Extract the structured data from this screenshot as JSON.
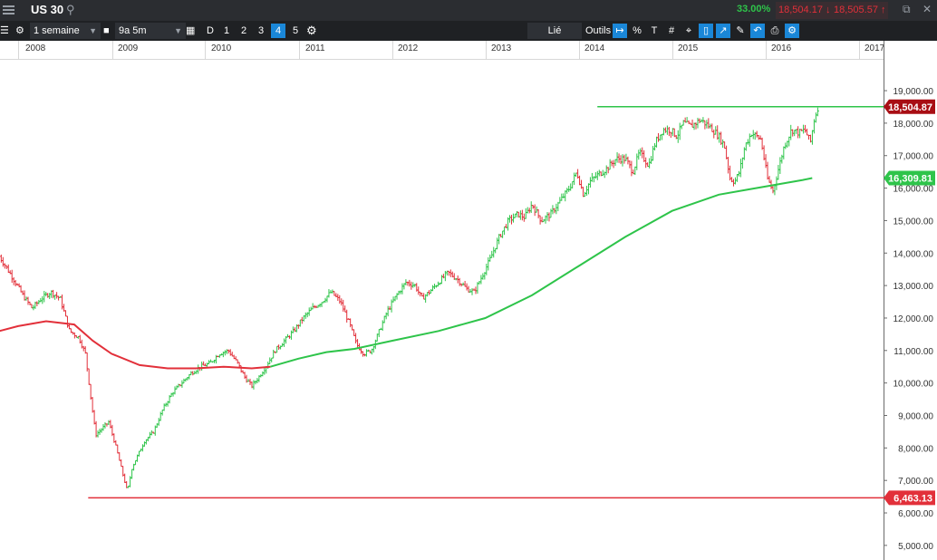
{
  "window": {
    "instrument": "US 30",
    "change_pct": "33.00%",
    "bid": "18,504.17",
    "ask": "18,505.57",
    "colors": {
      "up": "#2ec44a",
      "down": "#e2303a"
    }
  },
  "toolbar": {
    "period": "1 semaine",
    "range": "9a 5m",
    "day_label": "D",
    "numbers": [
      "1",
      "2",
      "3",
      "4",
      "5"
    ],
    "active_number": "4",
    "link_label": "Lié",
    "tools_label": "Outils"
  },
  "chart_data": {
    "type": "ohlc",
    "x_tick_labels": [
      "2008",
      "2009",
      "2010",
      "2011",
      "2012",
      "2013",
      "2014",
      "2015",
      "2016",
      "2017"
    ],
    "y_tick_labels": [
      "5,000.00",
      "6,000.00",
      "7,000.00",
      "8,000.00",
      "9,000.00",
      "10,000.00",
      "11,000.00",
      "12,000.00",
      "13,000.00",
      "14,000.00",
      "15,000.00",
      "16,000.00",
      "17,000.00",
      "18,000.00",
      "19,000.00"
    ],
    "y_ticks": [
      5000,
      6000,
      7000,
      8000,
      9000,
      10000,
      11000,
      12000,
      13000,
      14000,
      15000,
      16000,
      17000,
      18000,
      19000
    ],
    "ylim": [
      4550,
      19950
    ],
    "xlim": [
      2007.8,
      2017.3
    ],
    "price_path": [
      [
        2007.8,
        13900
      ],
      [
        2007.95,
        13200
      ],
      [
        2008.05,
        12700
      ],
      [
        2008.15,
        12300
      ],
      [
        2008.25,
        12600
      ],
      [
        2008.35,
        12800
      ],
      [
        2008.45,
        12600
      ],
      [
        2008.55,
        11600
      ],
      [
        2008.65,
        11400
      ],
      [
        2008.72,
        10900
      ],
      [
        2008.78,
        9500
      ],
      [
        2008.83,
        8400
      ],
      [
        2008.9,
        8600
      ],
      [
        2008.97,
        8800
      ],
      [
        2009.05,
        8000
      ],
      [
        2009.12,
        7200
      ],
      [
        2009.17,
        6650
      ],
      [
        2009.22,
        7400
      ],
      [
        2009.35,
        8200
      ],
      [
        2009.45,
        8500
      ],
      [
        2009.55,
        9200
      ],
      [
        2009.65,
        9700
      ],
      [
        2009.75,
        10000
      ],
      [
        2009.85,
        10300
      ],
      [
        2009.95,
        10500
      ],
      [
        2010.05,
        10600
      ],
      [
        2010.15,
        10900
      ],
      [
        2010.25,
        11000
      ],
      [
        2010.35,
        10600
      ],
      [
        2010.42,
        10200
      ],
      [
        2010.5,
        9900
      ],
      [
        2010.58,
        10200
      ],
      [
        2010.65,
        10500
      ],
      [
        2010.75,
        11000
      ],
      [
        2010.85,
        11300
      ],
      [
        2010.95,
        11600
      ],
      [
        2011.05,
        12000
      ],
      [
        2011.15,
        12300
      ],
      [
        2011.25,
        12500
      ],
      [
        2011.35,
        12800
      ],
      [
        2011.45,
        12500
      ],
      [
        2011.55,
        11800
      ],
      [
        2011.62,
        11200
      ],
      [
        2011.7,
        10900
      ],
      [
        2011.78,
        11000
      ],
      [
        2011.88,
        11700
      ],
      [
        2011.95,
        12200
      ],
      [
        2012.05,
        12700
      ],
      [
        2012.15,
        13100
      ],
      [
        2012.25,
        13000
      ],
      [
        2012.32,
        12600
      ],
      [
        2012.4,
        12800
      ],
      [
        2012.5,
        13100
      ],
      [
        2012.6,
        13400
      ],
      [
        2012.7,
        13200
      ],
      [
        2012.8,
        12900
      ],
      [
        2012.88,
        12800
      ],
      [
        2012.95,
        13200
      ],
      [
        2013.05,
        13800
      ],
      [
        2013.15,
        14500
      ],
      [
        2013.25,
        15000
      ],
      [
        2013.35,
        15200
      ],
      [
        2013.42,
        15100
      ],
      [
        2013.5,
        15500
      ],
      [
        2013.6,
        15000
      ],
      [
        2013.7,
        15200
      ],
      [
        2013.8,
        15600
      ],
      [
        2013.9,
        16000
      ],
      [
        2013.98,
        16500
      ],
      [
        2014.05,
        15800
      ],
      [
        2014.12,
        16200
      ],
      [
        2014.2,
        16400
      ],
      [
        2014.3,
        16600
      ],
      [
        2014.4,
        16900
      ],
      [
        2014.5,
        16900
      ],
      [
        2014.58,
        16500
      ],
      [
        2014.65,
        17100
      ],
      [
        2014.75,
        16700
      ],
      [
        2014.82,
        17400
      ],
      [
        2014.9,
        17800
      ],
      [
        2014.98,
        17800
      ],
      [
        2015.05,
        17600
      ],
      [
        2015.12,
        18000
      ],
      [
        2015.2,
        17900
      ],
      [
        2015.3,
        18100
      ],
      [
        2015.4,
        17900
      ],
      [
        2015.5,
        17600
      ],
      [
        2015.56,
        17300
      ],
      [
        2015.62,
        16300
      ],
      [
        2015.67,
        16200
      ],
      [
        2015.72,
        16500
      ],
      [
        2015.78,
        17300
      ],
      [
        2015.85,
        17700
      ],
      [
        2015.95,
        17500
      ],
      [
        2016.02,
        16300
      ],
      [
        2016.08,
        15900
      ],
      [
        2016.13,
        16500
      ],
      [
        2016.2,
        17300
      ],
      [
        2016.28,
        17800
      ],
      [
        2016.36,
        17700
      ],
      [
        2016.42,
        17800
      ],
      [
        2016.48,
        17400
      ],
      [
        2016.52,
        18100
      ],
      [
        2016.56,
        18500
      ]
    ],
    "ma_red": [
      [
        2007.8,
        11600
      ],
      [
        2008.0,
        11750
      ],
      [
        2008.3,
        11900
      ],
      [
        2008.6,
        11800
      ],
      [
        2008.8,
        11300
      ],
      [
        2009.0,
        10900
      ],
      [
        2009.3,
        10550
      ],
      [
        2009.6,
        10450
      ],
      [
        2009.9,
        10450
      ],
      [
        2010.2,
        10500
      ],
      [
        2010.5,
        10450
      ],
      [
        2010.7,
        10500
      ]
    ],
    "ma_green": [
      [
        2010.7,
        10500
      ],
      [
        2011.0,
        10750
      ],
      [
        2011.3,
        10950
      ],
      [
        2011.6,
        11050
      ],
      [
        2012.0,
        11300
      ],
      [
        2012.5,
        11600
      ],
      [
        2013.0,
        12000
      ],
      [
        2013.5,
        12700
      ],
      [
        2014.0,
        13600
      ],
      [
        2014.5,
        14500
      ],
      [
        2015.0,
        15300
      ],
      [
        2015.5,
        15800
      ],
      [
        2015.8,
        15950
      ],
      [
        2016.1,
        16100
      ],
      [
        2016.4,
        16250
      ],
      [
        2016.5,
        16309.81
      ]
    ],
    "levels": [
      {
        "value": 18504.87,
        "label": "18,504.87",
        "color": "#2ec44a",
        "x_start": 2014.2
      },
      {
        "value": 6463.13,
        "label": "6,463.13",
        "color": "#e2303a",
        "x_start": 2008.75
      }
    ],
    "ma_label": {
      "value": 16309.81,
      "label": "16,309.81",
      "color": "#2ec44a"
    },
    "last_price": {
      "value": 18504.87,
      "label": "18,504.87",
      "color": "#a80e14"
    },
    "grid": false
  }
}
